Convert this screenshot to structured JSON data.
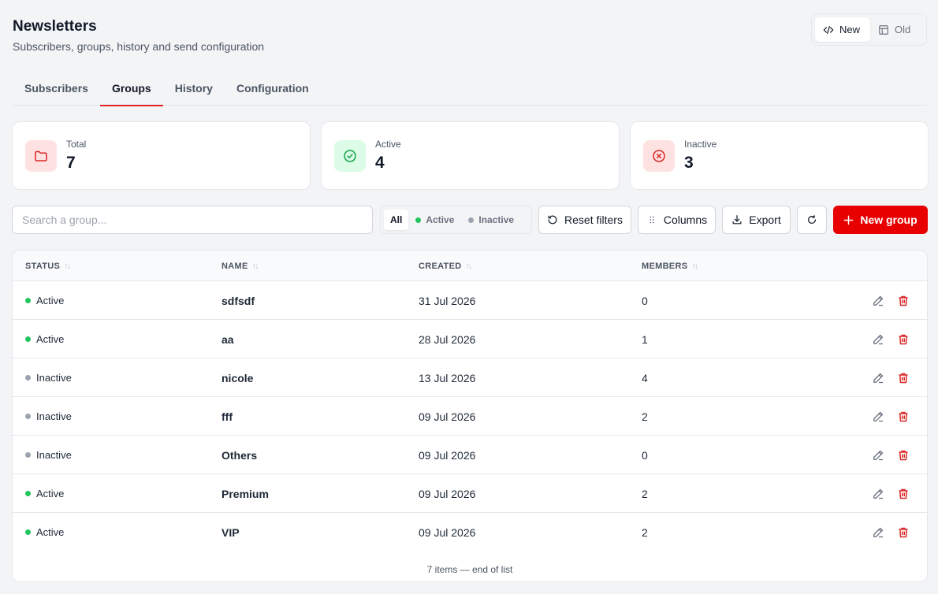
{
  "header": {
    "title": "Newsletters",
    "subtitle": "Subscribers, groups, history and send configuration"
  },
  "version_toggle": {
    "new_label": "New",
    "old_label": "Old",
    "selected": "New"
  },
  "tabs": [
    {
      "label": "Subscribers",
      "active": false
    },
    {
      "label": "Groups",
      "active": true
    },
    {
      "label": "History",
      "active": false
    },
    {
      "label": "Configuration",
      "active": false
    }
  ],
  "stats": {
    "total": {
      "label": "Total",
      "value": "7",
      "icon": "folder-icon"
    },
    "active": {
      "label": "Active",
      "value": "4",
      "icon": "check-circle-icon"
    },
    "inactive": {
      "label": "Inactive",
      "value": "3",
      "icon": "x-circle-icon"
    }
  },
  "toolbar": {
    "search_placeholder": "Search a group...",
    "search_value": "",
    "filter_all": "All",
    "filter_active": "Active",
    "filter_inactive": "Inactive",
    "filter_selected": "All",
    "reset_filters": "Reset filters",
    "columns": "Columns",
    "export": "Export",
    "new_group": "New group"
  },
  "table": {
    "columns": {
      "status": "STATUS",
      "name": "NAME",
      "created": "CREATED",
      "members": "MEMBERS"
    },
    "rows": [
      {
        "status": "Active",
        "name": "sdfsdf",
        "created": "31 Jul 2026",
        "members": "0"
      },
      {
        "status": "Active",
        "name": "aa",
        "created": "28 Jul 2026",
        "members": "1"
      },
      {
        "status": "Inactive",
        "name": "nicole",
        "created": "13 Jul 2026",
        "members": "4"
      },
      {
        "status": "Inactive",
        "name": "fff",
        "created": "09 Jul 2026",
        "members": "2"
      },
      {
        "status": "Inactive",
        "name": "Others",
        "created": "09 Jul 2026",
        "members": "0"
      },
      {
        "status": "Active",
        "name": "Premium",
        "created": "09 Jul 2026",
        "members": "2"
      },
      {
        "status": "Active",
        "name": "VIP",
        "created": "09 Jul 2026",
        "members": "2"
      }
    ],
    "footer": "7 items — end of list"
  },
  "colors": {
    "accent": "#e80000",
    "active_dot": "#22c55e",
    "inactive_dot": "#9ca3af",
    "delete_icon": "#dc2626"
  }
}
